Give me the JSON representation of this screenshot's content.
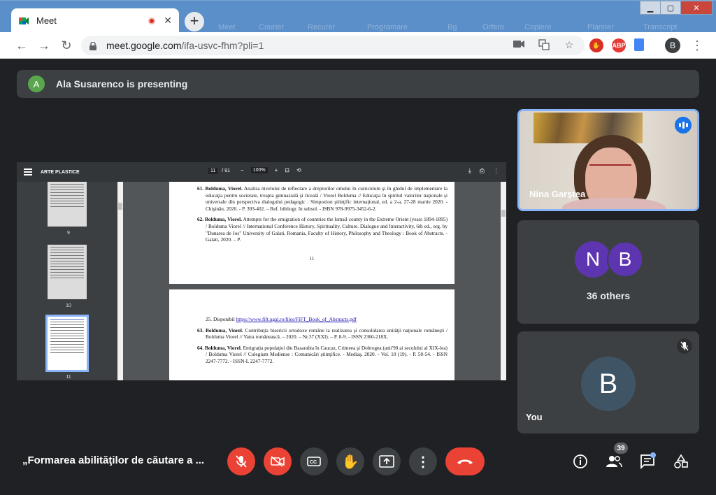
{
  "browser": {
    "tab_title": "Meet",
    "url_host": "meet.google.com",
    "url_path": "/ifa-usvc-fhm?pli=1",
    "profile_initial": "B",
    "bookmarks_faint": [
      "Meet",
      "Courier",
      "Recurer",
      "Programare",
      "Bg",
      "Orfero",
      "Copiere",
      "Planner",
      "Transcript"
    ],
    "abp_label": "ABP"
  },
  "banner": {
    "avatar_initial": "A",
    "text": "Ala Susarenco is presenting"
  },
  "pdf": {
    "title": "ARTE PLASTICE",
    "page_current": "11",
    "page_total": "/ 91",
    "zoom": "100%",
    "thumb_numbers": [
      "9",
      "10",
      "11"
    ],
    "page1": {
      "entry61_author": "61. Bolduma, Viorel.",
      "entry61_text": " Analiza nivelului de reflectare a drepturilor omului în curriculum şi în ghidul de implementare la educaţia pentru societate, treapta gimnazială şi liceală / Viorel Bolduma // Educaţia în spiritul valorilor naţionale şi universale din perspectiva dialogului pedagogic : Simpozion ştiinţific internaţional, ed. a 2-a, 27-28 martie 2020. - Chişinău, 2020. - P. 393-402. – Ref. bibliogr. în subsol. - ISBN 978-9975-3452-6-2.",
      "entry62_author": "62. Bolduma, Viorel.",
      "entry62_text": " Attempts for the emigration of countries the Ismail county in the Extreme Orient (years 1894-1895) / Bolduma Viorel // International Conference History, Spirituality, Culture. Dialogue and Interactivity, 6th ed., org. by \"Dunarea de Jos\" University of Galati, Romania, Faculty of History, Philosophy and Theology : Book of Abstracts. - Galati, 2020. – P.",
      "page_number": "11"
    },
    "page2": {
      "footnote_num": "25.",
      "footnote_label": "Disponibil",
      "footnote_link": "https://www.fift.ugal.ro/files/FIFT_Book_of_Abstracts.pdf",
      "entry63_author": "63. Bolduma, Viorel.",
      "entry63_text": " Contribuţia bisericii ortodoxe române la realizarea şi consolidarea unităţii naţionale româneşti / Bolduma Viorel // Vatra românească. – 2020. – Nr.37 (XXI). – P. 8-9. - ISSN 2360-218X.",
      "entry64_author": "64. Bolduma, Viorel.",
      "entry64_text": " Emigraţia populaţiei din Basarabia în Caucaz, Crimeea şi Dobrogea (anii'90 ai secolului al XIX-lea) / Bolduma Viorel // Colegium Mediense : Comunicări ştiinţifice. - Mediaş, 2020. - Vol. 10 (19). - P. 50-54. - ISSN 2247-7772. - ISSN-L 2247-7772."
    }
  },
  "tiles": {
    "speaker_name": "Nina Garştea",
    "avatar_n": "N",
    "avatar_b": "B",
    "others_label": "36 others",
    "self_initial": "B",
    "self_label": "You"
  },
  "controls": {
    "meeting_title": "„Formarea abilităţilor de căutare a ...",
    "participants_count": "39"
  },
  "colors": {
    "accent_blue": "#8ab4f8",
    "danger_red": "#ea4335",
    "meet_bg": "#202124",
    "tile_bg": "#3c4043"
  }
}
